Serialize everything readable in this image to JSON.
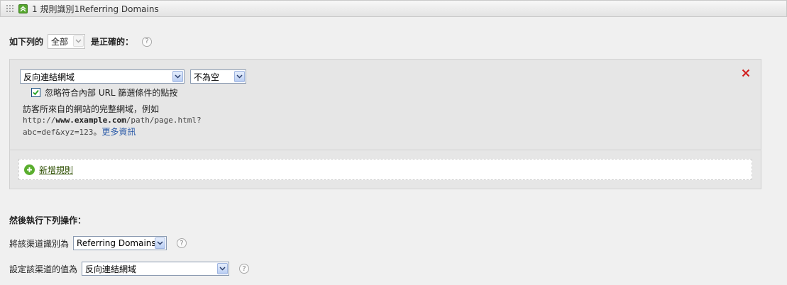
{
  "header": {
    "title": "1 規則識別1Referring Domains"
  },
  "condition": {
    "prefix": "如下列的",
    "match_value": "全部",
    "suffix": "是正確的："
  },
  "rule": {
    "field_value": "反向連結網域",
    "operator_value": "不為空",
    "ignore_internal_label": "忽略符合內部 URL 篩選條件的點按",
    "ignore_internal_checked": true,
    "description_line1": "訪客所來自的網站的完整網域，例如",
    "example_pre": "http://",
    "example_bold": "www.example.com",
    "example_post": "/path/page.html?",
    "example_line3": "abc=def&xyz=123",
    "example_sep": "。",
    "more_info": "更多資訊"
  },
  "add_rule_label": "新增規則",
  "actions": {
    "heading": "然後執行下列操作：",
    "identify_label": "將該渠道識別為",
    "identify_value": "Referring Domains",
    "set_value_label": "設定該渠道的值為",
    "set_value_value": "反向連結網域"
  },
  "colors": {
    "accent_green": "#5aae2e",
    "delete_red": "#d11a1a",
    "link_blue": "#2a5aa8"
  }
}
